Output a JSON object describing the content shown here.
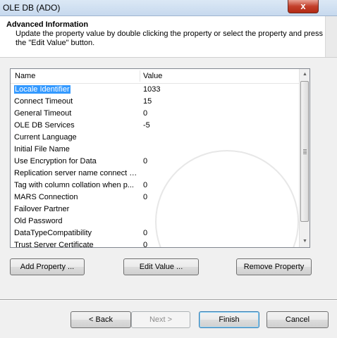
{
  "window": {
    "title": "OLE DB (ADO)",
    "close_label": "x"
  },
  "header": {
    "title": "Advanced Information",
    "description": "Update the property value by double clicking the property or select the property and press the \"Edit Value\" button."
  },
  "list": {
    "columns": {
      "name": "Name",
      "value": "Value"
    },
    "rows": [
      {
        "name": "Locale Identifier",
        "value": "1033"
      },
      {
        "name": "Connect Timeout",
        "value": "15"
      },
      {
        "name": "General Timeout",
        "value": "0"
      },
      {
        "name": "OLE DB Services",
        "value": "-5"
      },
      {
        "name": "Current Language",
        "value": ""
      },
      {
        "name": "Initial File Name",
        "value": ""
      },
      {
        "name": "Use Encryption for Data",
        "value": "0"
      },
      {
        "name": "Replication server name connect o...",
        "value": ""
      },
      {
        "name": "Tag with column collation when p...",
        "value": "0"
      },
      {
        "name": "MARS Connection",
        "value": "0"
      },
      {
        "name": "Failover Partner",
        "value": ""
      },
      {
        "name": "Old Password",
        "value": ""
      },
      {
        "name": "DataTypeCompatibility",
        "value": "0"
      },
      {
        "name": "Trust Server Certificate",
        "value": "0"
      }
    ],
    "selected_index": 0
  },
  "actions": {
    "add_property": "Add Property ...",
    "edit_value": "Edit Value ...",
    "remove_property": "Remove Property"
  },
  "footer": {
    "back": "< Back",
    "next": "Next >",
    "finish": "Finish",
    "cancel": "Cancel"
  }
}
